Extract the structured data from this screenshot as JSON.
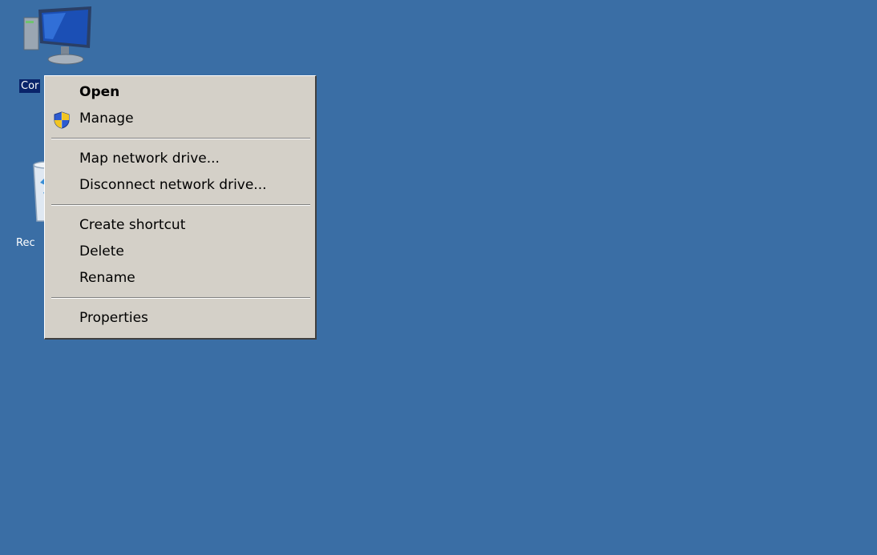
{
  "desktop": {
    "background_color": "#3a6ea5",
    "icons": [
      {
        "name": "computer-icon",
        "label": "Cor",
        "selected": true
      },
      {
        "name": "recycle-bin-icon",
        "label": "Rec",
        "selected": false
      }
    ]
  },
  "context_menu": {
    "groups": [
      [
        {
          "label": "Open",
          "default": true
        },
        {
          "label": "Manage",
          "icon": "uac-shield-icon"
        }
      ],
      [
        {
          "label": "Map network drive..."
        },
        {
          "label": "Disconnect network drive..."
        }
      ],
      [
        {
          "label": "Create shortcut"
        },
        {
          "label": "Delete"
        },
        {
          "label": "Rename"
        }
      ],
      [
        {
          "label": "Properties"
        }
      ]
    ]
  },
  "colors": {
    "menu_background": "#d4d0c8",
    "selection": "#0a246a"
  }
}
